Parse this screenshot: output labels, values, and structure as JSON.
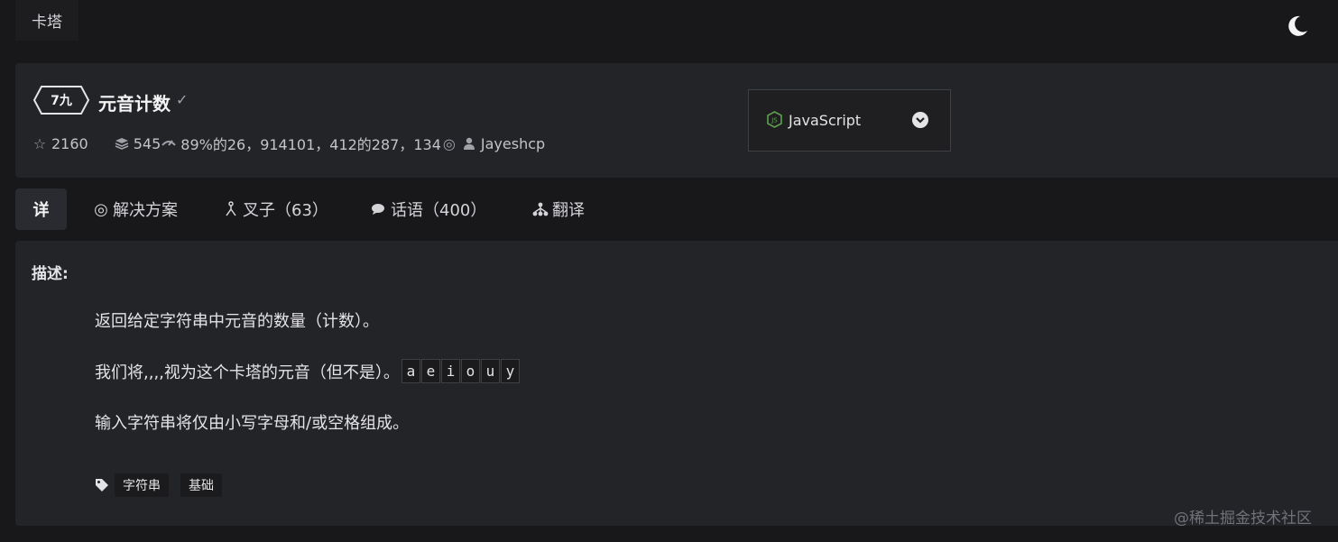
{
  "brand": "卡塔",
  "kata": {
    "rank": "7九",
    "title": "元音计数",
    "stars": "2160",
    "stats_text": "545",
    "satisfaction_text": "89%的26，914101，412的287，134",
    "author": "Jayeshcp"
  },
  "language": {
    "selected": "JavaScript"
  },
  "tabs": [
    {
      "label": "详"
    },
    {
      "label": "解决方案"
    },
    {
      "label": "叉子（63）"
    },
    {
      "label": "话语（400）"
    },
    {
      "label": "翻译"
    }
  ],
  "description": {
    "label": "描述:",
    "line1": "返回给定字符串中元音的数量（计数）。",
    "line2": "我们将,,,,视为这个卡塔的元音（但不是）。",
    "vowels": [
      "a",
      "e",
      "i",
      "o",
      "u",
      "y"
    ],
    "line3": "输入字符串将仅由小写字母和/或空格组成。"
  },
  "tags": [
    "字符串",
    "基础"
  ],
  "watermark": "@稀土掘金技术社区",
  "colors": {
    "background": "#18181b",
    "card": "#232428",
    "text": "#e4e4e7"
  }
}
